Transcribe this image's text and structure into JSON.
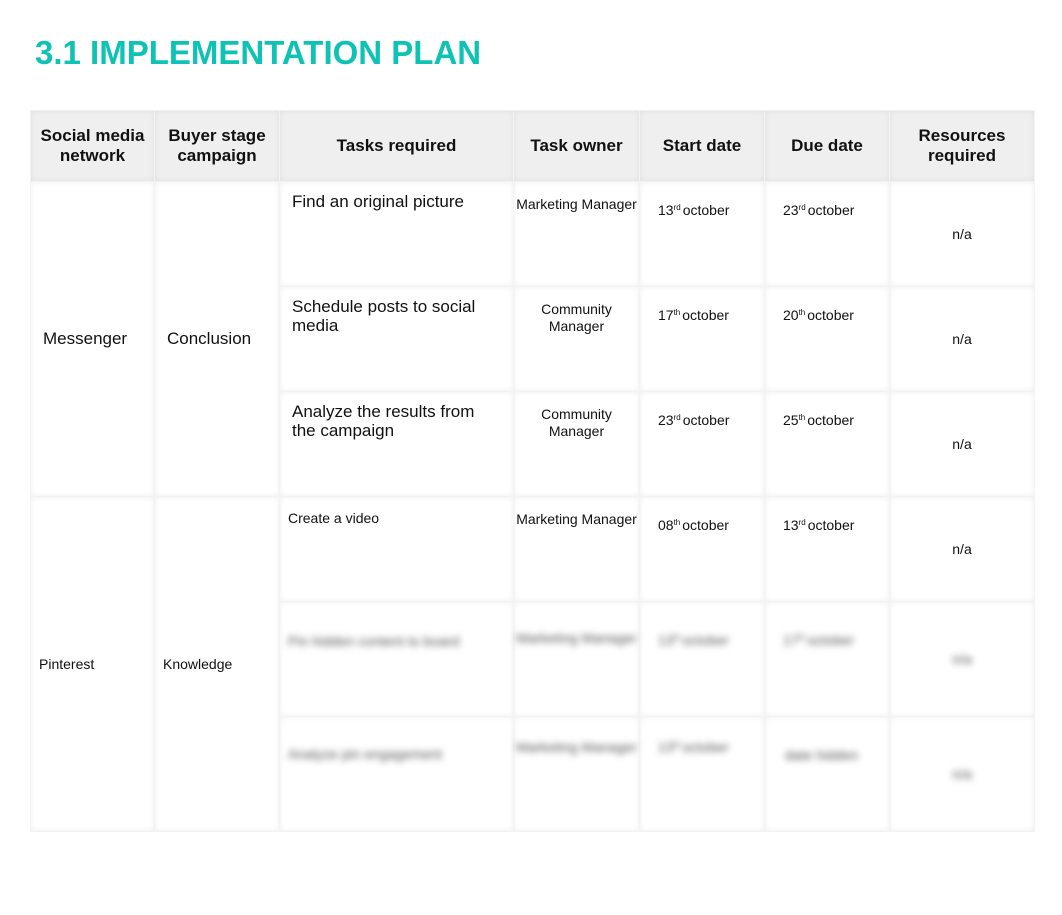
{
  "title": "3.1 IMPLEMENTATION PLAN",
  "accent_color": "#0ec2b4",
  "table": {
    "headers": [
      "Social media network",
      "Buyer stage campaign",
      "Tasks required",
      "Task owner",
      "Start date",
      "Due date",
      "Resources required"
    ],
    "groups": [
      {
        "network": "Messenger",
        "stage": "Conclusion",
        "rows": [
          {
            "task": "Find an original picture",
            "owner": "Marketing Manager",
            "start_day": "13",
            "start_suffix": "rd",
            "start_month": "october",
            "due_day": "23",
            "due_suffix": "rd",
            "due_month": "october",
            "resources": "n/a"
          },
          {
            "task": "Schedule posts to social media",
            "owner": "Community Manager",
            "start_day": "17",
            "start_suffix": "th",
            "start_month": "october",
            "due_day": "20",
            "due_suffix": "th",
            "due_month": "october",
            "resources": "n/a"
          },
          {
            "task": "Analyze the results from the campaign",
            "owner": "Community Manager",
            "start_day": "23",
            "start_suffix": "rd",
            "start_month": "october",
            "due_day": "25",
            "due_suffix": "th",
            "due_month": "october",
            "resources": "n/a"
          }
        ]
      },
      {
        "network": "Pinterest",
        "stage": "Knowledge",
        "rows": [
          {
            "task": "Create a video",
            "owner": "Marketing Manager",
            "start_day": "08",
            "start_suffix": "th",
            "start_month": "october",
            "due_day": "13",
            "due_suffix": "rd",
            "due_month": "october",
            "resources": "n/a"
          },
          {
            "task": "Pin hidden content to board",
            "owner": "Marketing Manager",
            "start_day": "13",
            "start_suffix": "th",
            "start_month": "october",
            "due_day": "17",
            "due_suffix": "th",
            "due_month": "october",
            "resources": "n/a",
            "blurred": true
          },
          {
            "task": "Analyze pin engagement",
            "owner": "Marketing Manager",
            "start_day": "13",
            "start_suffix": "th",
            "start_month": "october",
            "due_day": "",
            "due_suffix": "",
            "due_month": "date hidden",
            "resources": "n/a",
            "blurred": true
          }
        ]
      }
    ]
  }
}
